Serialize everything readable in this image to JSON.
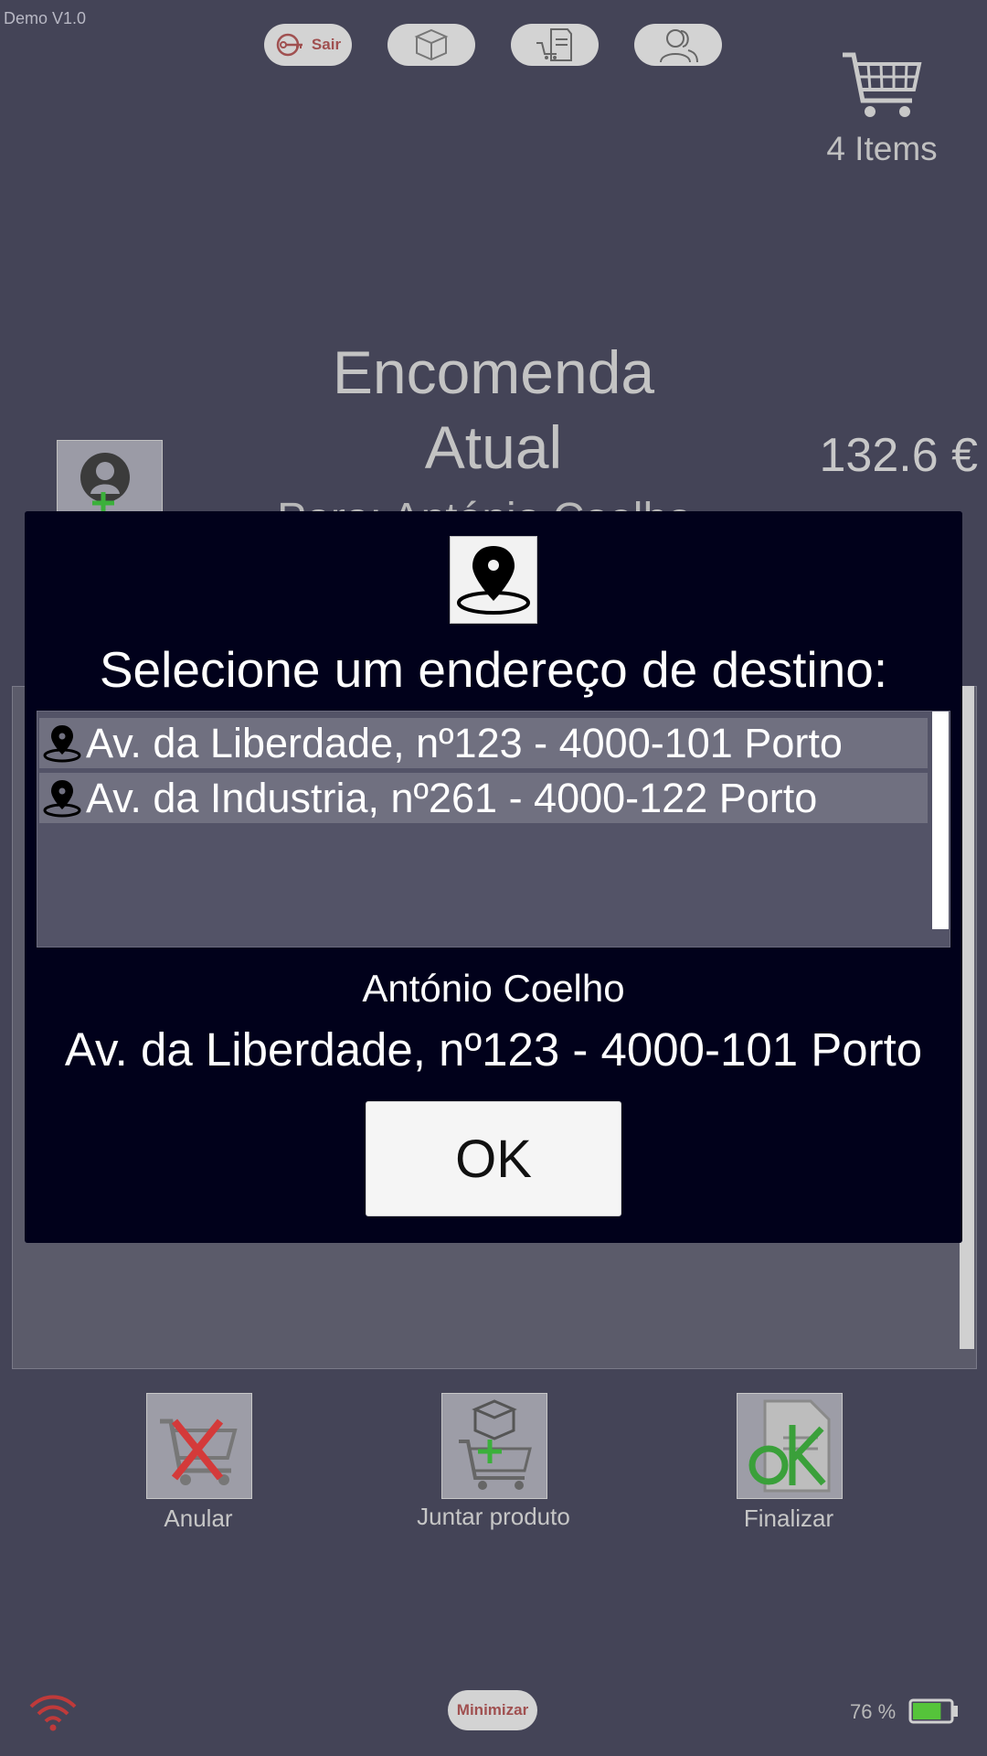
{
  "app": {
    "version": "Demo V1.0"
  },
  "toolbar": {
    "sair_label": "Sair",
    "icons": [
      "key-icon",
      "box-icon",
      "cart-document-icon",
      "users-icon"
    ]
  },
  "cart": {
    "count_label": "4 Items"
  },
  "order": {
    "title": "Encomenda Atual",
    "subtitle": "Para: António Coelho",
    "total": "132.6 €"
  },
  "modal": {
    "title": "Selecione um endereço de destino:",
    "addresses": [
      {
        "label": "Av. da Liberdade, nº123 - 4000-101 Porto"
      },
      {
        "label": "Av. da Industria, nº261 - 4000-122 Porto"
      }
    ],
    "selected_name": "António Coelho",
    "selected_address": "Av. da Liberdade, nº123 - 4000-101 Porto",
    "ok_label": "OK"
  },
  "actions": {
    "anular_label": "Anular",
    "juntar_label": "Juntar produto",
    "finalizar_label": "Finalizar"
  },
  "status": {
    "minimizar_label": "Minimizar",
    "battery_label": "76 %",
    "battery_level": 0.76,
    "colors": {
      "battery": "#55c43a",
      "wifi": "#c03a3a",
      "accent_text": "#a05050"
    }
  }
}
